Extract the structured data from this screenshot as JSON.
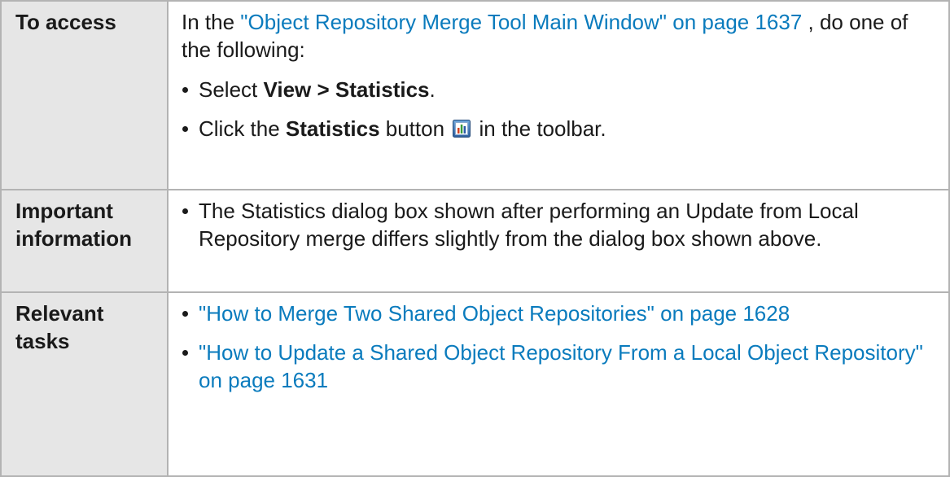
{
  "rows": {
    "access": {
      "header": "To access",
      "intro_prefix": "In the ",
      "intro_link": "\"Object Repository Merge Tool Main Window\" on page 1637",
      "intro_suffix": " , do one of the following:",
      "items": [
        {
          "prefix": "Select ",
          "bold": "View > Statistics",
          "suffix": "."
        },
        {
          "prefix": "Click the ",
          "bold": "Statistics",
          "middle": " button ",
          "icon": "statistics-chart-icon",
          "suffix": " in the toolbar."
        }
      ]
    },
    "important": {
      "header": "Important information",
      "items": [
        {
          "text": "The Statistics dialog box shown after performing an Update from Local Repository merge differs slightly from the dialog box shown above."
        }
      ]
    },
    "tasks": {
      "header": "Relevant tasks",
      "items": [
        {
          "link": "\"How to Merge Two Shared Object Repositories\" on page 1628"
        },
        {
          "link": "\"How to Update a Shared Object Repository From a Local Object Repository\" on page 1631"
        }
      ]
    }
  },
  "colors": {
    "link": "#0a7bbd",
    "header_bg": "#e6e6e6",
    "border": "#b3b3b3"
  }
}
